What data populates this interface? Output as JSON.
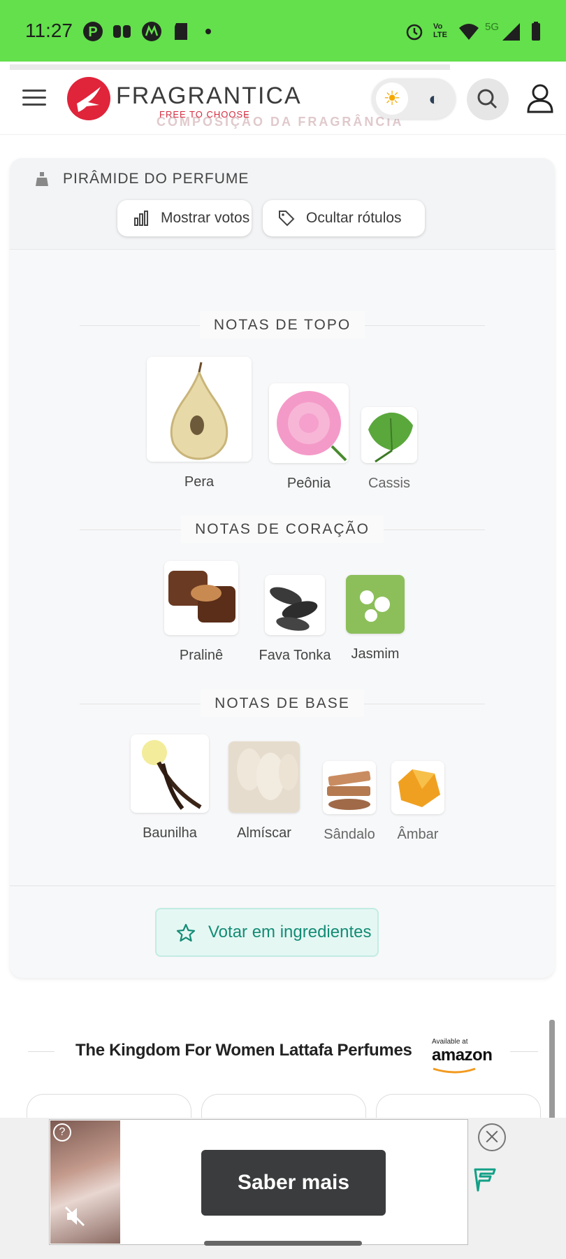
{
  "status_bar": {
    "time": "11:27",
    "icons": [
      "pinterest-icon",
      "quote-app-icon",
      "motorola-icon",
      "sd-card-icon",
      "dot-icon",
      "alarm-icon",
      "volte-icon",
      "wifi-icon",
      "5g-icon",
      "signal-icon",
      "battery-icon"
    ],
    "network_label": "5G",
    "volte_label": "Vo LTE",
    "background": "#63e04b"
  },
  "header": {
    "logo_text": "FRAGRANTICA",
    "logo_tagline": "FREE TO CHOOSE",
    "behind_header_text": "COMPOSIÇÃO DA FRAGRÂNCIA",
    "brand_color": "#e0243a"
  },
  "pyramid": {
    "title": "PIRÂMIDE DO PERFUME",
    "show_votes_label": "Mostrar votos",
    "hide_labels_label": "Ocultar rótulos",
    "top_notes": {
      "title": "NOTAS DE TOPO",
      "items": [
        {
          "name": "Pera",
          "icon": "pear-image"
        },
        {
          "name": "Peônia",
          "icon": "peony-image"
        },
        {
          "name": "Cassis",
          "icon": "cassis-leaf-image"
        }
      ]
    },
    "heart_notes": {
      "title": "NOTAS DE CORAÇÃO",
      "items": [
        {
          "name": "Pralinê",
          "icon": "praline-image"
        },
        {
          "name": "Fava Tonka",
          "icon": "tonka-bean-image"
        },
        {
          "name": "Jasmim",
          "icon": "jasmine-image"
        }
      ]
    },
    "base_notes": {
      "title": "NOTAS DE BASE",
      "items": [
        {
          "name": "Baunilha",
          "icon": "vanilla-image"
        },
        {
          "name": "Almíscar",
          "icon": "musk-image"
        },
        {
          "name": "Sândalo",
          "icon": "sandalwood-image"
        },
        {
          "name": "Âmbar",
          "icon": "amber-image"
        }
      ]
    },
    "vote_button_label": "Votar em ingredientes",
    "accent_color": "#138c75"
  },
  "amazon": {
    "title": "The Kingdom For Women Lattafa Perfumes",
    "available_at": "Available at",
    "logo_word": "amazon"
  },
  "ad": {
    "cta_label": "Saber mais",
    "help_label": "?"
  }
}
